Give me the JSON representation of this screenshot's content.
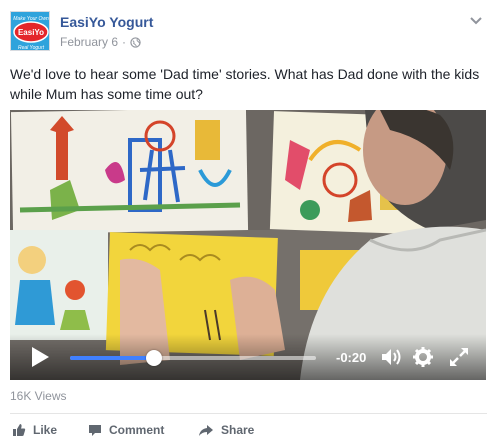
{
  "post": {
    "author": "EasiYo Yogurt",
    "date": "February 6",
    "separator": "·",
    "privacy_icon": "globe-icon",
    "menu_icon": "chevron-down-icon",
    "text": "We'd love to hear some 'Dad time' stories. What has Dad done with the kids while Mum has some time out?",
    "logo": {
      "text": "EasiYo",
      "tagline_top": "Make Your Own",
      "tagline_bottom": "Real Yogurt",
      "colors": {
        "background": "#2fa3dc",
        "badge": "#e4262a"
      }
    }
  },
  "video": {
    "progress": 0.34,
    "time_remaining": "-0:20",
    "controls": {
      "play_icon": "play-icon",
      "volume_icon": "volume-icon",
      "settings_icon": "gear-icon",
      "fullscreen_icon": "fullscreen-icon"
    },
    "colors": {
      "progress": "#4080ff"
    }
  },
  "stats": {
    "views": "16K Views"
  },
  "actions": {
    "like": "Like",
    "comment": "Comment",
    "share": "Share"
  },
  "colors": {
    "link": "#365899",
    "meta": "#90949c",
    "action": "#606770"
  }
}
